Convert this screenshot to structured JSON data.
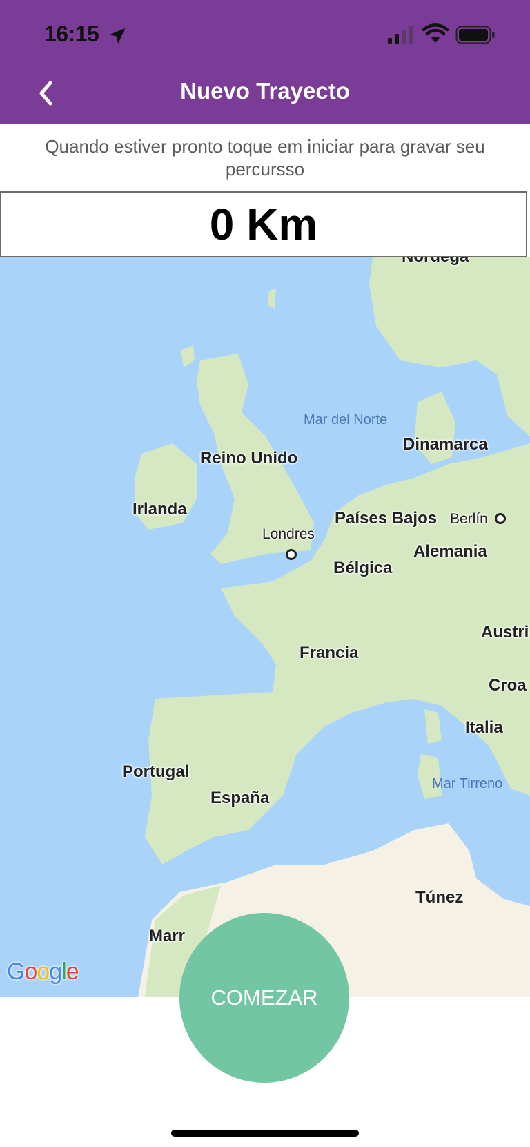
{
  "status_bar": {
    "time": "16:15"
  },
  "header": {
    "title": "Nuevo Trayecto",
    "background": "#7b3c97"
  },
  "instructions": "Quando estiver pronto toque em iniciar para gravar seu percursso",
  "distance": {
    "value": "0 Km"
  },
  "map": {
    "labels": {
      "noruega": "Noruega",
      "mar_norte": "Mar del Norte",
      "dinamarca": "Dinamarca",
      "reino_unido": "Reino Unido",
      "irlanda": "Irlanda",
      "londres": "Londres",
      "paises_bajos": "Países Bajos",
      "berlin": "Berlín",
      "alemania": "Alemania",
      "belgica": "Bélgica",
      "austria": "Austri",
      "francia": "Francia",
      "croacia": "Croa",
      "italia": "Italia",
      "portugal": "Portugal",
      "espana": "España",
      "mar_tirreno": "Mar Tirreno",
      "tunez": "Túnez",
      "marruecos": "Marr"
    },
    "attribution": "Google",
    "colors": {
      "water": "#aad3fa",
      "land": "#d6e8c1",
      "desert": "#f5f1e4"
    }
  },
  "start_button": {
    "label": "COMEZAR",
    "color": "#72c6a3"
  }
}
